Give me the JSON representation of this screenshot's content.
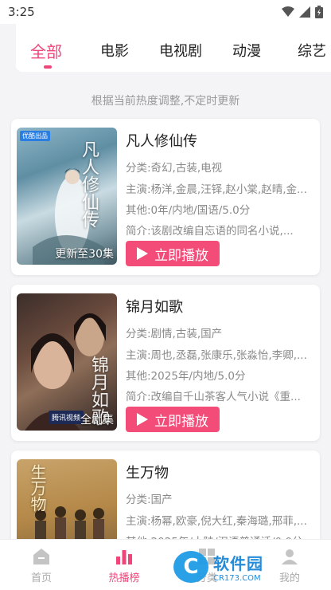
{
  "status": {
    "time": "3:25"
  },
  "tabs": [
    {
      "label": "全部",
      "active": true
    },
    {
      "label": "电影",
      "active": false
    },
    {
      "label": "电视剧",
      "active": false
    },
    {
      "label": "动漫",
      "active": false
    },
    {
      "label": "综艺",
      "active": false
    }
  ],
  "notice": "根据当前热度调整,不定时更新",
  "items": [
    {
      "title": "凡人修仙传",
      "category": "分类:奇幻,古装,电视",
      "cast": "主演:杨洋,金晨,汪铎,赵小棠,赵晴,金...",
      "other": "其他:0年/内地/国语/5.0分",
      "intro": "简介:该剧改编自忘语的同名小说,...",
      "poster_caption": "更新至30集",
      "poster_tag": "优酷出品",
      "poster_art": "凡人修仙传",
      "play_label": "立即播放"
    },
    {
      "title": "锦月如歌",
      "category": "分类:剧情,古装,国产",
      "cast": "主演:周也,丞磊,张康乐,张淼怡,李卿,...",
      "other": "其他:2025年/内地/5.0分",
      "intro": "简介:改编自千山茶客人气小说《重...",
      "poster_caption": "全剧集",
      "poster_art": "锦月如歌",
      "poster_stamp": "腾讯视频",
      "play_label": "立即播放"
    },
    {
      "title": "生万物",
      "category": "分类:国产",
      "cast": "主演:杨幂,欧豪,倪大红,秦海璐,邢菲,...",
      "other": "其他:2025年/大陆/汉语普通话/0.0分",
      "poster_art": "生万物"
    }
  ],
  "nav": [
    {
      "label": "首页",
      "icon": "home-icon",
      "active": false
    },
    {
      "label": "热播榜",
      "icon": "chart-icon",
      "active": true
    },
    {
      "label": "分类",
      "icon": "category-icon",
      "active": false
    },
    {
      "label": "我的",
      "icon": "user-icon",
      "active": false
    }
  ],
  "watermark": {
    "main": "软件园",
    "sub": "CR173.COM",
    "logo": "C"
  },
  "colors": {
    "accent": "#f0457a",
    "button": "#f34c78"
  }
}
